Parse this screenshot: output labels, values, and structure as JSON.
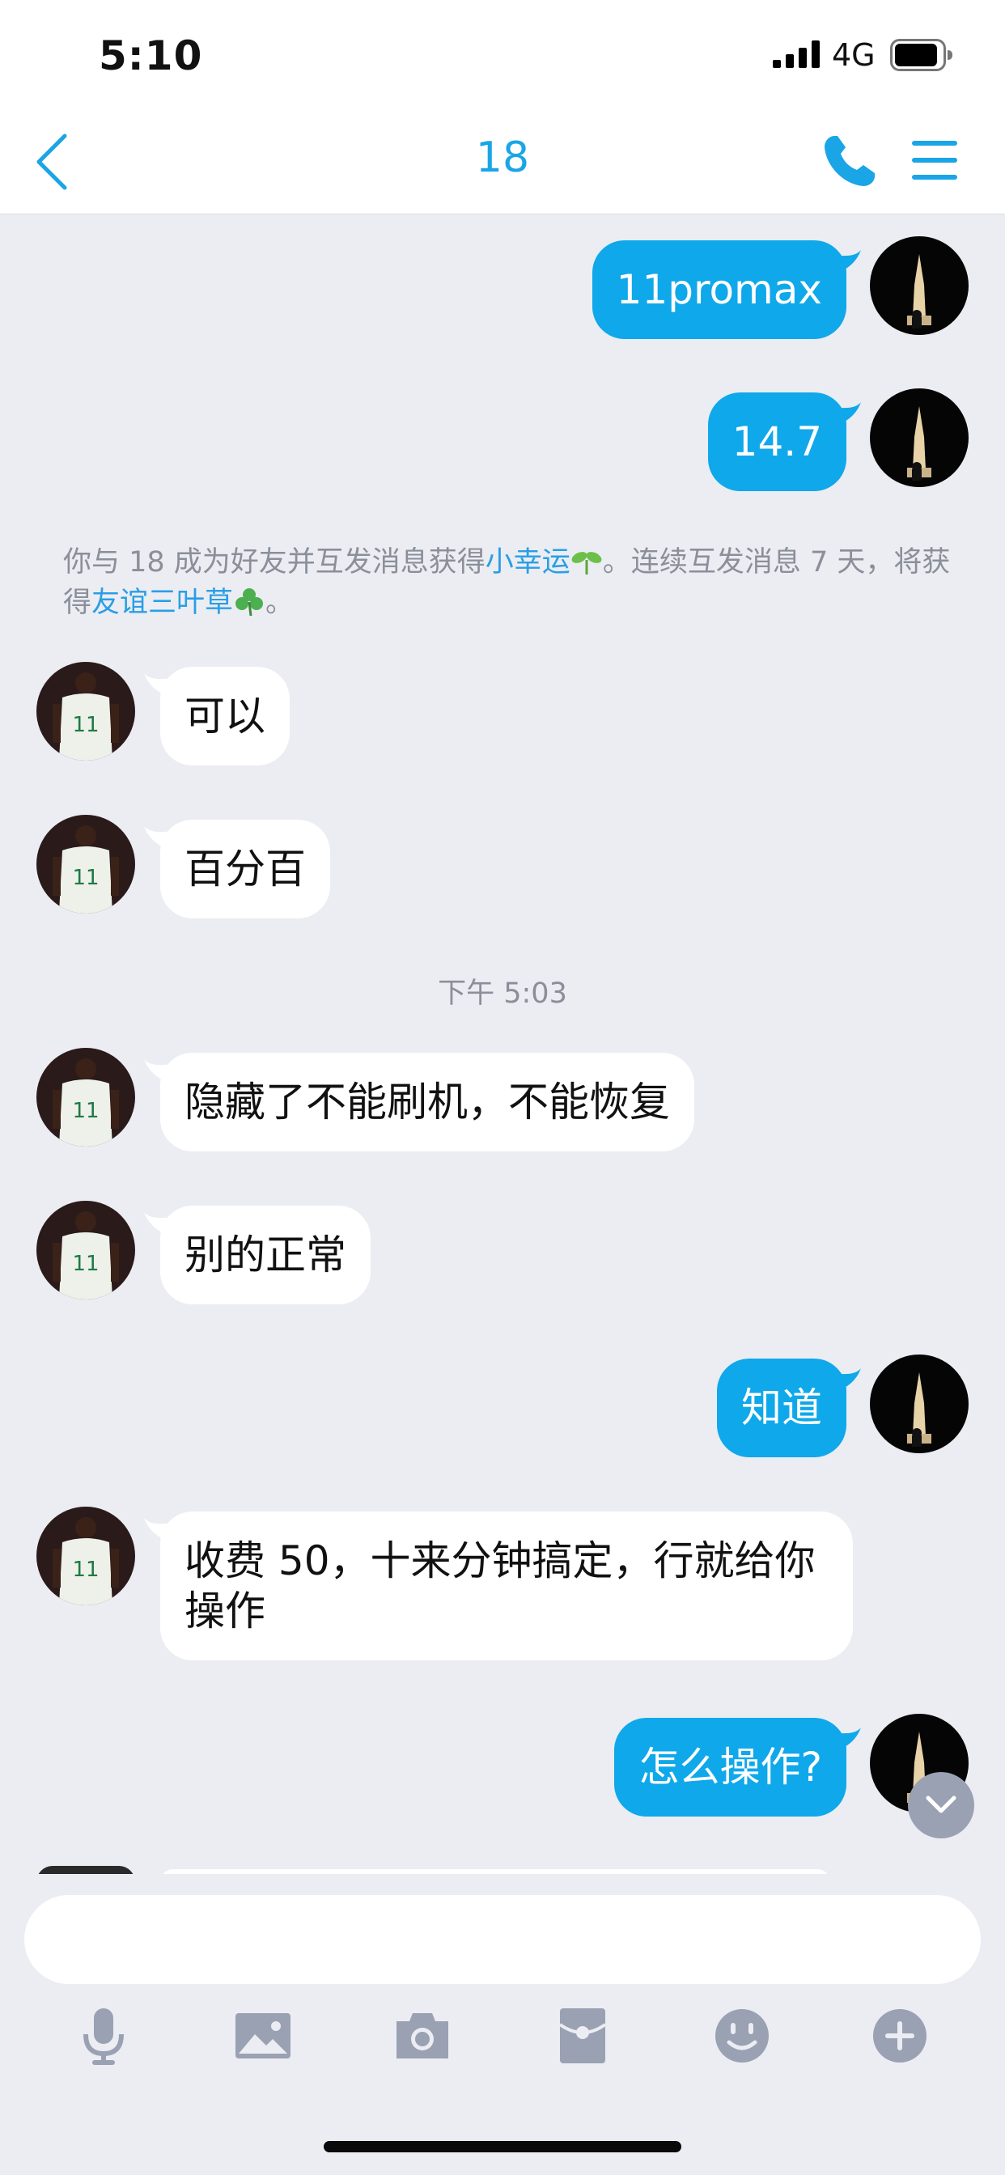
{
  "status_bar": {
    "time": "5:10",
    "network": "4G"
  },
  "nav": {
    "title": "18"
  },
  "messages": [
    {
      "text": "11promax"
    },
    {
      "text": "14.7"
    },
    {
      "text": "可以"
    },
    {
      "text": "百分百"
    },
    {
      "text": "隐藏了不能刷机，不能恢复"
    },
    {
      "text": "别的正常"
    },
    {
      "text": "知道"
    },
    {
      "text": "收费 50，十来分钟搞定，行就给你操作"
    },
    {
      "text": "怎么操作?"
    }
  ],
  "system_note": {
    "part1": "你与 18 成为好友并互发消息获得",
    "link1": "小幸运",
    "part2": "。连续互发消息 7 天，将获得",
    "link2": "友谊三叶草",
    "part3": "。"
  },
  "time_divider": "下午 5:03",
  "composer": {
    "toolbar": [
      "microphone-icon",
      "image-icon",
      "camera-icon",
      "red-packet-icon",
      "emoji-icon",
      "plus-icon"
    ]
  },
  "colors": {
    "accent": "#1aa5e6",
    "bubble_out": "#0fa8ea",
    "background": "#ebedf2"
  }
}
